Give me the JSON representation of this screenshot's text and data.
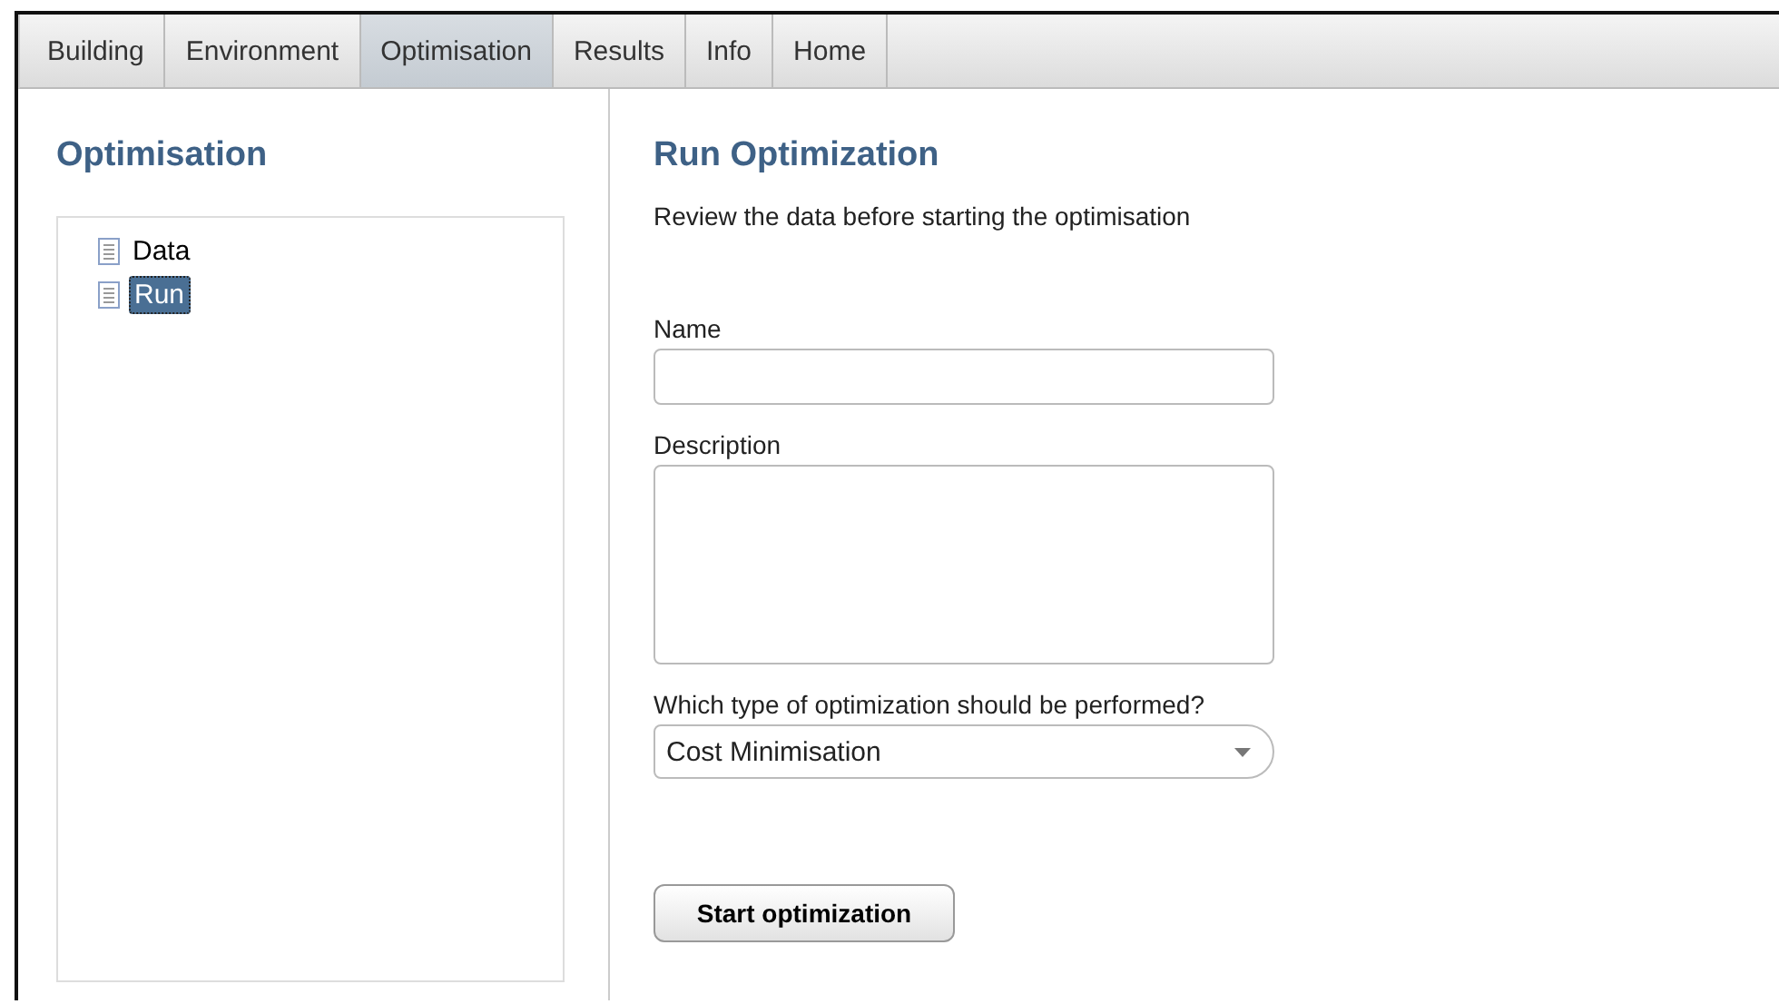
{
  "tabs": [
    {
      "label": "Building",
      "selected": false
    },
    {
      "label": "Environment",
      "selected": false
    },
    {
      "label": "Optimisation",
      "selected": true
    },
    {
      "label": "Results",
      "selected": false
    },
    {
      "label": "Info",
      "selected": false
    },
    {
      "label": "Home",
      "selected": false
    }
  ],
  "sidebar": {
    "title": "Optimisation",
    "items": [
      {
        "label": "Data",
        "selected": false
      },
      {
        "label": "Run",
        "selected": true
      }
    ]
  },
  "main": {
    "title": "Run Optimization",
    "intro": "Review the data before starting the optimisation",
    "name_label": "Name",
    "description_label": "Description",
    "type_label": "Which type of optimization should be performed?",
    "type_value": "Cost Minimisation",
    "button": "Start optimization"
  }
}
